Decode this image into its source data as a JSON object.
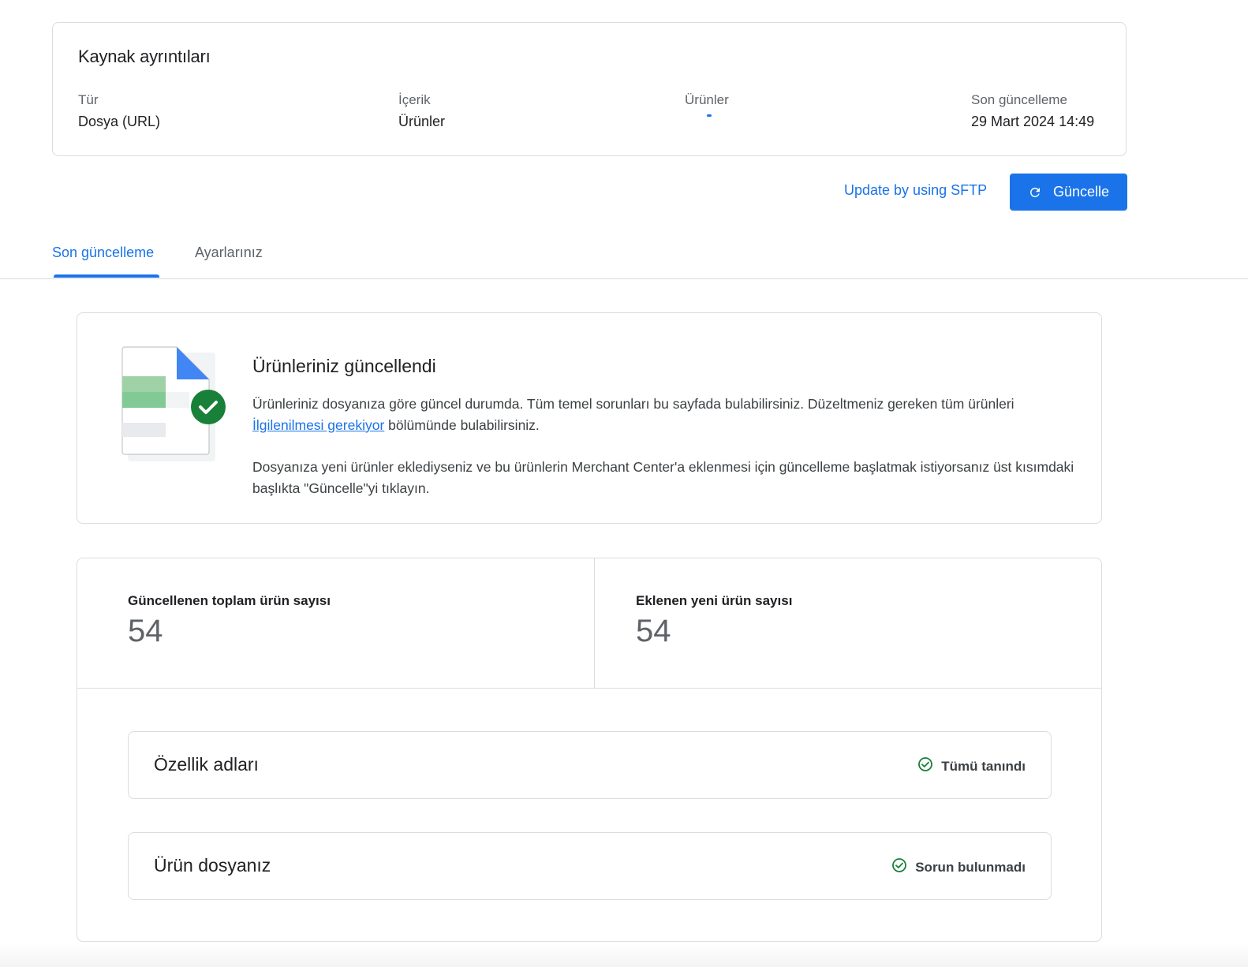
{
  "source_details": {
    "title": "Kaynak ayrıntıları",
    "type": {
      "label": "Tür",
      "value": "Dosya (URL)"
    },
    "content": {
      "label": "İçerik",
      "value": "Ürünler"
    },
    "products": {
      "label": "Ürünler"
    },
    "last_update": {
      "label": "Son güncelleme",
      "value": "29 Mart 2024 14:49"
    }
  },
  "actions": {
    "sftp_link": "Update by using SFTP",
    "update_button": "Güncelle"
  },
  "tabs": [
    {
      "label": "Son güncelleme",
      "active": true
    },
    {
      "label": "Ayarlarınız",
      "active": false
    }
  ],
  "status": {
    "title": "Ürünleriniz güncellendi",
    "paragraph1_before": "Ürünleriniz dosyanıza göre güncel durumda. Tüm temel sorunları bu sayfada bulabilirsiniz. Düzeltmeniz gereken tüm ürünleri ",
    "paragraph1_link": "İlgilenilmesi gerekiyor",
    "paragraph1_after": " bölümünde bulabilirsiniz.",
    "paragraph2": "Dosyanıza yeni ürünler eklediyseniz ve bu ürünlerin Merchant Center'a eklenmesi için güncelleme başlatmak istiyorsanız üst kısımdaki başlıkta \"Güncelle\"yi tıklayın."
  },
  "stats": {
    "total_updated": {
      "label": "Güncellenen toplam ürün sayısı",
      "value": "54"
    },
    "new_added": {
      "label": "Eklenen yeni ürün sayısı",
      "value": "54"
    }
  },
  "details": [
    {
      "title": "Özellik adları",
      "status": "Tümü tanındı"
    },
    {
      "title": "Ürün dosyanız",
      "status": "Sorun bulunmadı"
    }
  ],
  "colors": {
    "accent": "#1a73e8",
    "success": "#188038",
    "border": "#dadce0"
  }
}
